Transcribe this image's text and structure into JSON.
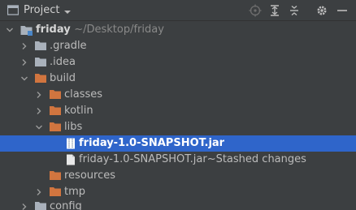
{
  "panel": {
    "title": "Project"
  },
  "tree": {
    "root": {
      "name": "friday",
      "path": "~/Desktop/friday"
    },
    "items": [
      {
        "label": ".gradle"
      },
      {
        "label": ".idea"
      },
      {
        "label": "build"
      },
      {
        "label": "classes"
      },
      {
        "label": "kotlin"
      },
      {
        "label": "libs"
      },
      {
        "label": "friday-1.0-SNAPSHOT.jar"
      },
      {
        "label": "friday-1.0-SNAPSHOT.jar~Stashed changes"
      },
      {
        "label": "resources"
      },
      {
        "label": "tmp"
      },
      {
        "label": "config"
      }
    ]
  },
  "colors": {
    "background": "#3c3f41",
    "selection": "#2f65ca",
    "folder_gray": "#a9b1bb",
    "folder_orange": "#d1753f"
  }
}
